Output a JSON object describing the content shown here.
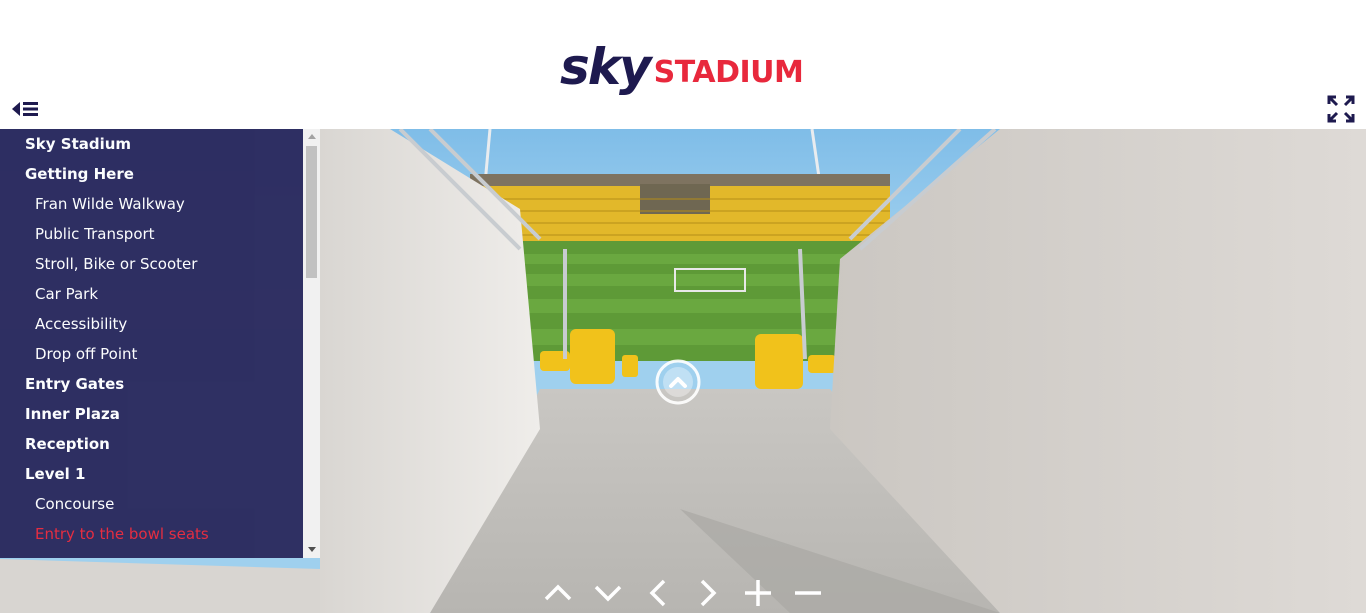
{
  "header": {
    "logo": {
      "part1": "sky",
      "part2": "STADIUM"
    },
    "menu_toggle_icon": "menu-collapse-icon",
    "fullscreen_icon": "fullscreen-icon"
  },
  "sidebar": {
    "items": [
      {
        "label": "Sky Stadium",
        "level": 0
      },
      {
        "label": "Getting Here",
        "level": 0
      },
      {
        "label": "Fran Wilde Walkway",
        "level": 1
      },
      {
        "label": "Public Transport",
        "level": 1
      },
      {
        "label": "Stroll, Bike or Scooter",
        "level": 1
      },
      {
        "label": "Car Park",
        "level": 1
      },
      {
        "label": "Accessibility",
        "level": 1
      },
      {
        "label": "Drop off Point",
        "level": 1
      },
      {
        "label": "Entry Gates",
        "level": 0
      },
      {
        "label": "Inner Plaza",
        "level": 0
      },
      {
        "label": "Reception",
        "level": 0
      },
      {
        "label": "Level 1",
        "level": 0
      },
      {
        "label": "Concourse",
        "level": 1
      },
      {
        "label": "Entry to the bowl seats",
        "level": 1,
        "active": true
      }
    ],
    "active_color": "#e8283c",
    "background_color": "#2b2a5e"
  },
  "controls": [
    {
      "icon": "arrow-up-icon"
    },
    {
      "icon": "arrow-down-icon"
    },
    {
      "icon": "arrow-left-icon"
    },
    {
      "icon": "arrow-right-icon"
    },
    {
      "icon": "zoom-in-icon"
    },
    {
      "icon": "zoom-out-icon"
    }
  ],
  "hotspot": {
    "icon": "chevron-up-icon"
  },
  "colors": {
    "brand_navy": "#1e1a4f",
    "brand_red": "#e8283c"
  }
}
